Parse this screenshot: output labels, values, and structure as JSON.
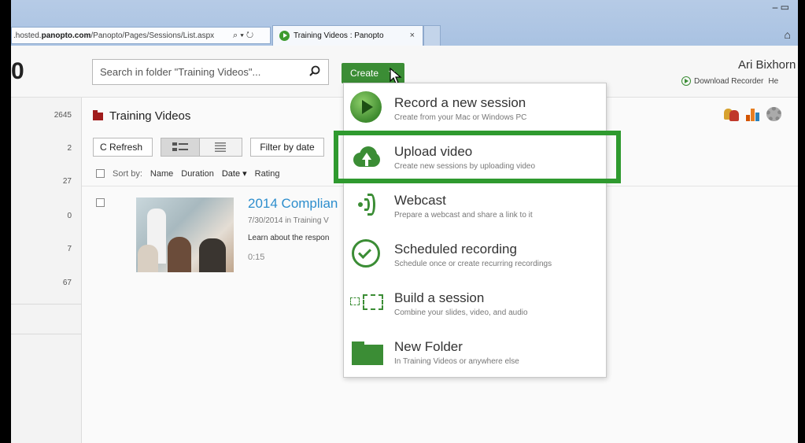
{
  "browser": {
    "url_prefix": ".hosted.",
    "url_domain": "panopto.com",
    "url_rest": "/Panopto/Pages/Sessions/List.aspx",
    "addr_icons": "⌕ ▾ ↻",
    "tab_title": "Training Videos : Panopto",
    "tab_close": "×",
    "window_buttons": "– ▭",
    "home_icon": "⌂"
  },
  "header": {
    "logo_fragment": "0",
    "search_placeholder": "Search in folder \"Training Videos\"...",
    "create_label": "Create",
    "user_name": "Ari Bixhorn",
    "download_recorder": "Download Recorder",
    "help_fragment": "He"
  },
  "sidebar": {
    "counts": [
      "2645",
      "2",
      "27",
      "0",
      "7",
      "67"
    ]
  },
  "main": {
    "folder_title": "Training Videos",
    "refresh_label": "C Refresh",
    "filter_label": "Filter by date",
    "sort_by_label": "Sort by:",
    "sort_name": "Name",
    "sort_duration": "Duration",
    "sort_date": "Date ▾",
    "sort_rating": "Rating",
    "session": {
      "title": "2014 Complian",
      "date": "7/30/2014 in Training V",
      "description": "Learn about the respon",
      "duration": "0:15"
    }
  },
  "create_menu": {
    "items": [
      {
        "title": "Record a new session",
        "subtitle": "Create from your Mac or Windows PC",
        "icon": "record-icon"
      },
      {
        "title": "Upload video",
        "subtitle": "Create new sessions by uploading video",
        "icon": "cloud-upload-icon"
      },
      {
        "title": "Webcast",
        "subtitle": "Prepare a webcast and share a link to it",
        "icon": "webcast-icon"
      },
      {
        "title": "Scheduled recording",
        "subtitle": "Schedule once or create recurring recordings",
        "icon": "clock-check-icon"
      },
      {
        "title": "Build a session",
        "subtitle": "Combine your slides, video, and audio",
        "icon": "build-session-icon"
      },
      {
        "title": "New Folder",
        "subtitle": "In Training Videos or anywhere else",
        "icon": "folder-icon"
      }
    ]
  },
  "colors": {
    "accent_green": "#3b8d35",
    "highlight_green": "#2f9a2f",
    "link_blue": "#2d8ecd"
  }
}
